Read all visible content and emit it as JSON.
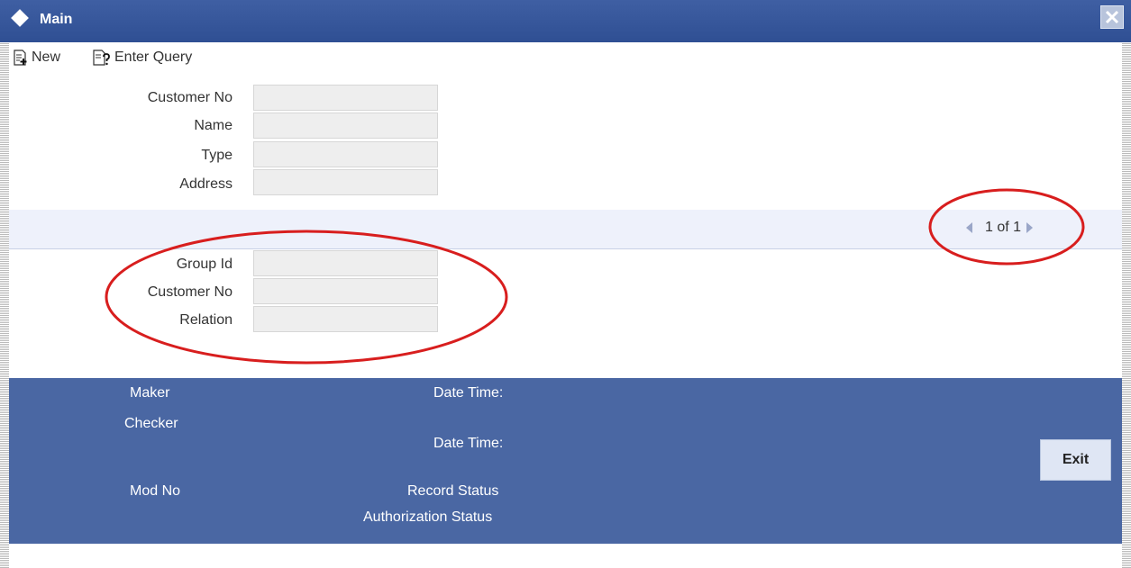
{
  "window": {
    "title": "Main"
  },
  "toolbar": {
    "new_label": "New",
    "enter_query_label": "Enter Query"
  },
  "form": {
    "customer_no_label": "Customer No",
    "name_label": "Name",
    "type_label": "Type",
    "address_label": "Address",
    "customer_no_value": "",
    "name_value": "",
    "type_value": "",
    "address_value": ""
  },
  "pager": {
    "text": "1 of 1"
  },
  "detail": {
    "group_id_label": "Group Id",
    "customer_no_label": "Customer No",
    "relation_label": "Relation",
    "group_id_value": "",
    "customer_no_value": "",
    "relation_value": ""
  },
  "footer": {
    "maker_label": "Maker",
    "checker_label": "Checker",
    "date_time_1": "Date Time:",
    "date_time_2": "Date Time:",
    "mod_no_label": "Mod No",
    "record_status_label": "Record Status",
    "authorization_status_label": "Authorization Status",
    "exit_label": "Exit"
  },
  "colors": {
    "titlebar": "#2f4f93",
    "footer": "#4a67a3",
    "annotation": "#d81e1e",
    "field_bg": "#eeeeee"
  }
}
